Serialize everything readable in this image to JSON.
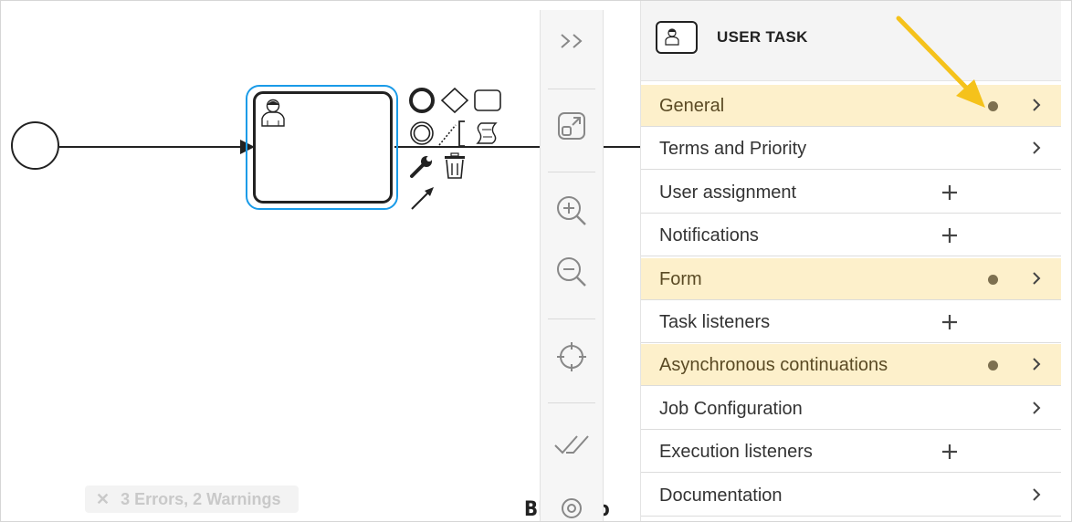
{
  "canvas": {
    "error_badge": {
      "icon": "close-icon",
      "text": "3 Errors, 2 Warnings"
    },
    "logo_text": "BPMN.io"
  },
  "toolbar": {
    "buttons": [
      "collapse-panel-icon",
      "open-minimap-icon",
      "zoom-in-icon",
      "zoom-out-icon",
      "reset-view-icon",
      "validate-icon",
      "settings-icon"
    ]
  },
  "panel": {
    "header": {
      "title": "USER TASK",
      "icon": "user-task-icon"
    },
    "groups": [
      {
        "label": "General",
        "action": "chevron",
        "has_data_dot": true,
        "highlighted": true
      },
      {
        "label": "Terms and Priority",
        "action": "chevron",
        "has_data_dot": false,
        "highlighted": false
      },
      {
        "label": "User assignment",
        "action": "plus",
        "has_data_dot": false,
        "highlighted": false
      },
      {
        "label": "Notifications",
        "action": "plus",
        "has_data_dot": false,
        "highlighted": false
      },
      {
        "label": "Form",
        "action": "chevron",
        "has_data_dot": true,
        "highlighted": true
      },
      {
        "label": "Task listeners",
        "action": "plus",
        "has_data_dot": false,
        "highlighted": false
      },
      {
        "label": "Asynchronous continuations",
        "action": "chevron",
        "has_data_dot": true,
        "highlighted": true
      },
      {
        "label": "Job Configuration",
        "action": "chevron",
        "has_data_dot": false,
        "highlighted": false
      },
      {
        "label": "Execution listeners",
        "action": "plus",
        "has_data_dot": false,
        "highlighted": false
      },
      {
        "label": "Documentation",
        "action": "chevron",
        "has_data_dot": false,
        "highlighted": false
      }
    ]
  },
  "colors": {
    "selection": "#1a9be8",
    "highlight": "#fdf0cb",
    "dot": "#7d7050",
    "annotation_arrow": "#f5c21b"
  }
}
